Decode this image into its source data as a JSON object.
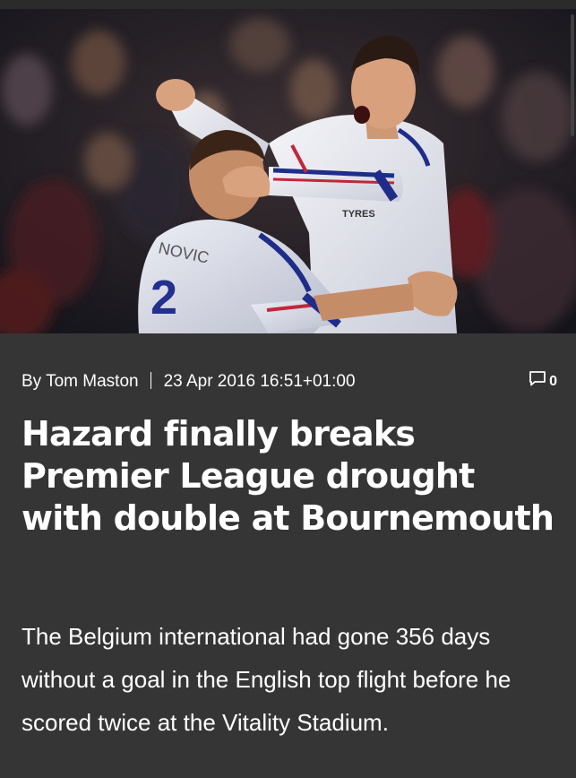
{
  "hero_image": {
    "shirt_lettering_left": "NOVIC",
    "shirt_lettering_right": "TYRES",
    "shirt_number": "2"
  },
  "article": {
    "byline": "By Tom Maston",
    "date": "23 Apr 2016 16:51+01:00",
    "comment_count": "0",
    "headline": "Hazard finally breaks Premier League drought with double at Bournemouth",
    "standfirst": "The Belgium international had gone 356 days without a goal in the English top flight before he scored twice at the Vitality Stadium."
  },
  "icons": {
    "comments": "comment-bubble-icon"
  },
  "colors": {
    "background": "#353535",
    "text": "#ffffff"
  }
}
